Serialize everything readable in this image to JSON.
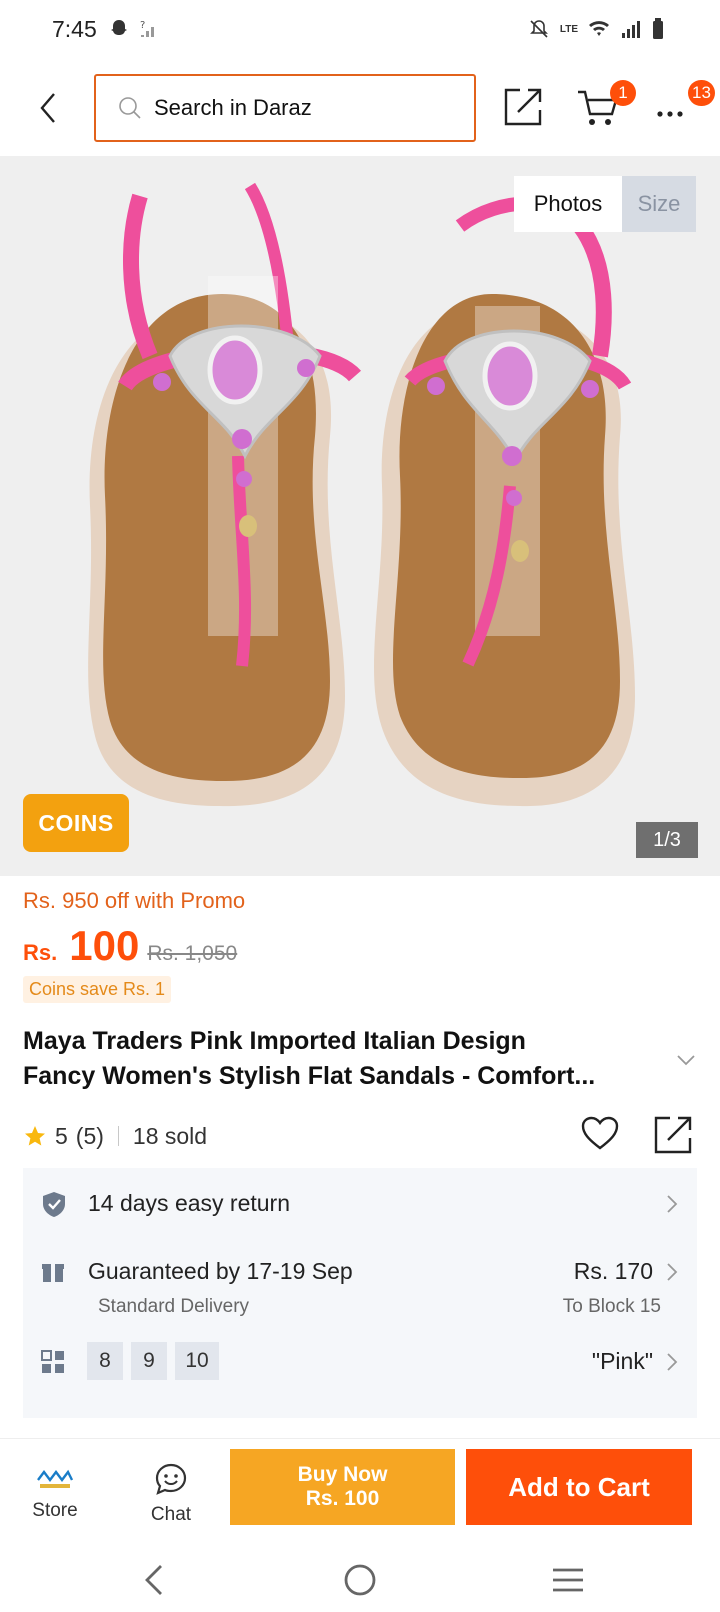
{
  "status_bar": {
    "time": "7:45",
    "network_label": "LTE"
  },
  "header": {
    "search_placeholder": "Search in Daraz",
    "cart_count": "1",
    "more_count": "13"
  },
  "gallery": {
    "tabs": [
      "Photos",
      "Size"
    ],
    "coins_label": "COINS",
    "counter": "1/3"
  },
  "price": {
    "promo": "Rs. 950 off with Promo",
    "currency": "Rs.",
    "value": "100",
    "original": "Rs. 1,050",
    "coins_save": "Coins save Rs. 1"
  },
  "product": {
    "title_line1": "Maya Traders Pink Imported Italian Design",
    "title_line2": "Fancy Women's Stylish Flat Sandals - Comfort..."
  },
  "rating": {
    "score": "5",
    "count": "(5)",
    "sold": "18 sold"
  },
  "services": {
    "return_text": "14 days easy return",
    "delivery_main": "Guaranteed by 17-19 Sep",
    "delivery_sub": "Standard Delivery",
    "delivery_price": "Rs. 170",
    "delivery_location": "To Block 15",
    "sizes": [
      "8",
      "9",
      "10"
    ],
    "color": "\"Pink\""
  },
  "action_bar": {
    "store_label": "Store",
    "chat_label": "Chat",
    "buy_now_line1": "Buy Now",
    "buy_now_line2": "Rs. 100",
    "add_to_cart": "Add to Cart"
  },
  "colors": {
    "accent": "#fe4f0a",
    "buy_now": "#f6a623",
    "coins": "#f3a10f",
    "sandal_strap": "#ee4f9c",
    "sole": "#b07942"
  }
}
